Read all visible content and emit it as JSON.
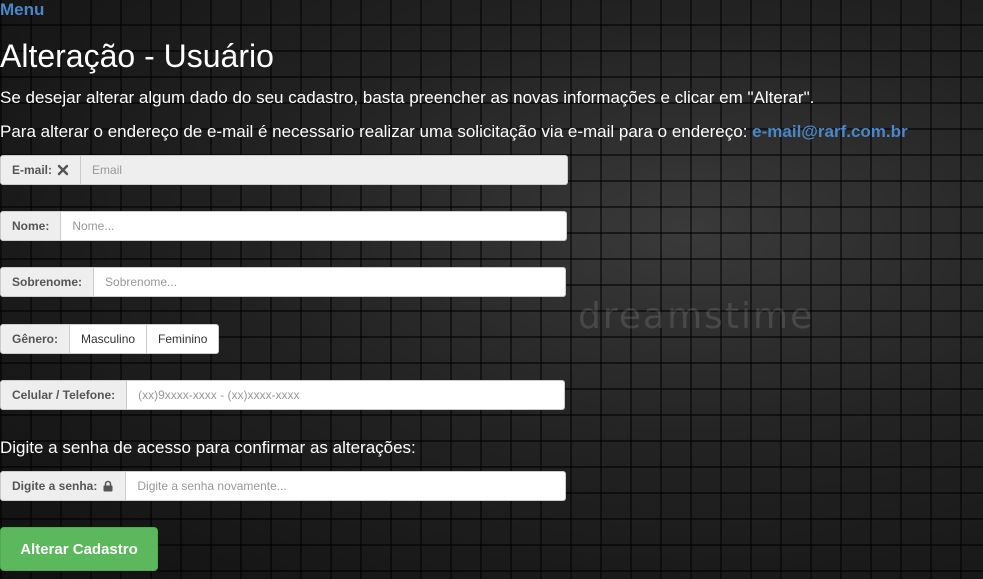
{
  "nav": {
    "menu_label": "Menu"
  },
  "page": {
    "title": "Alteração - Usuário",
    "info_line1": "Se desejar alterar algum dado do seu cadastro, basta preencher as novas informações e clicar em \"Alterar\".",
    "info_line2_text": "Para alterar o endereço de e-mail é necessario realizar uma solicitação via e-mail para o endereço: ",
    "info_line2_link": "e-mail@rarf.com.br",
    "confirm_text": "Digite a senha de acesso para confirmar as alterações:"
  },
  "form": {
    "email": {
      "label": "E-mail:",
      "placeholder": "Email",
      "icon": "times-icon"
    },
    "nome": {
      "label": "Nome:",
      "placeholder": "Nome..."
    },
    "sobrenome": {
      "label": "Sobrenome:",
      "placeholder": "Sobrenome..."
    },
    "genero": {
      "label": "Gênero:",
      "options": [
        "Masculino",
        "Feminino"
      ]
    },
    "telefone": {
      "label": "Celular / Telefone:",
      "placeholder": "(xx)9xxxx-xxxx - (xx)xxxx-xxxx"
    },
    "senha": {
      "label": "Digite a senha:",
      "placeholder": "Digite a senha novamente...",
      "icon": "lock-icon"
    },
    "submit_label": "Alterar Cadastro"
  },
  "background": {
    "watermark": "dreamstime"
  },
  "colors": {
    "link": "#4a86c8",
    "submit": "#5cb85c",
    "addon_bg": "#eeeeee"
  }
}
